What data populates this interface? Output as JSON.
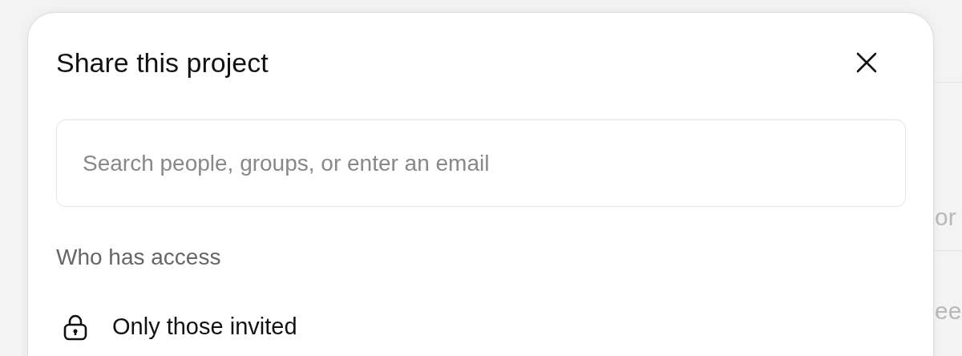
{
  "background": {
    "fragments": [
      "or",
      "ee"
    ]
  },
  "dialog": {
    "title": "Share this project",
    "search": {
      "placeholder": "Search people, groups, or enter an email"
    },
    "access_label": "Who has access",
    "access_option": {
      "label": "Only those invited"
    }
  }
}
